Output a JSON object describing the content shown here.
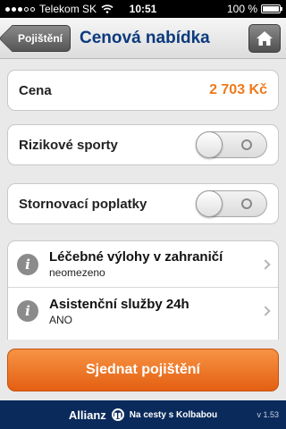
{
  "status_bar": {
    "carrier": "Telekom SK",
    "time": "10:51",
    "battery": "100 %"
  },
  "nav": {
    "back_label": "Pojištění",
    "title": "Cenová nabídka",
    "home_icon": "home-icon"
  },
  "price_row": {
    "label": "Cena",
    "value": "2 703 Kč"
  },
  "toggles": [
    {
      "label": "Rizikové sporty",
      "state": "off"
    },
    {
      "label": "Stornovací poplatky",
      "state": "off"
    }
  ],
  "coverage_list": [
    {
      "title": "Léčebné výlohy v zahraničí",
      "subtitle": "neomezeno"
    },
    {
      "title": "Asistenční služby 24h",
      "subtitle": "ANO"
    }
  ],
  "action": {
    "label": "Sjednat pojištění"
  },
  "footer": {
    "brand": "Allianz",
    "tagline": "Na cesty s Kolbabou",
    "version": "v 1.53"
  },
  "colors": {
    "accent_orange": "#ef7a1c",
    "title_blue": "#0b3a7d",
    "footer_navy": "#0a2a5c"
  }
}
